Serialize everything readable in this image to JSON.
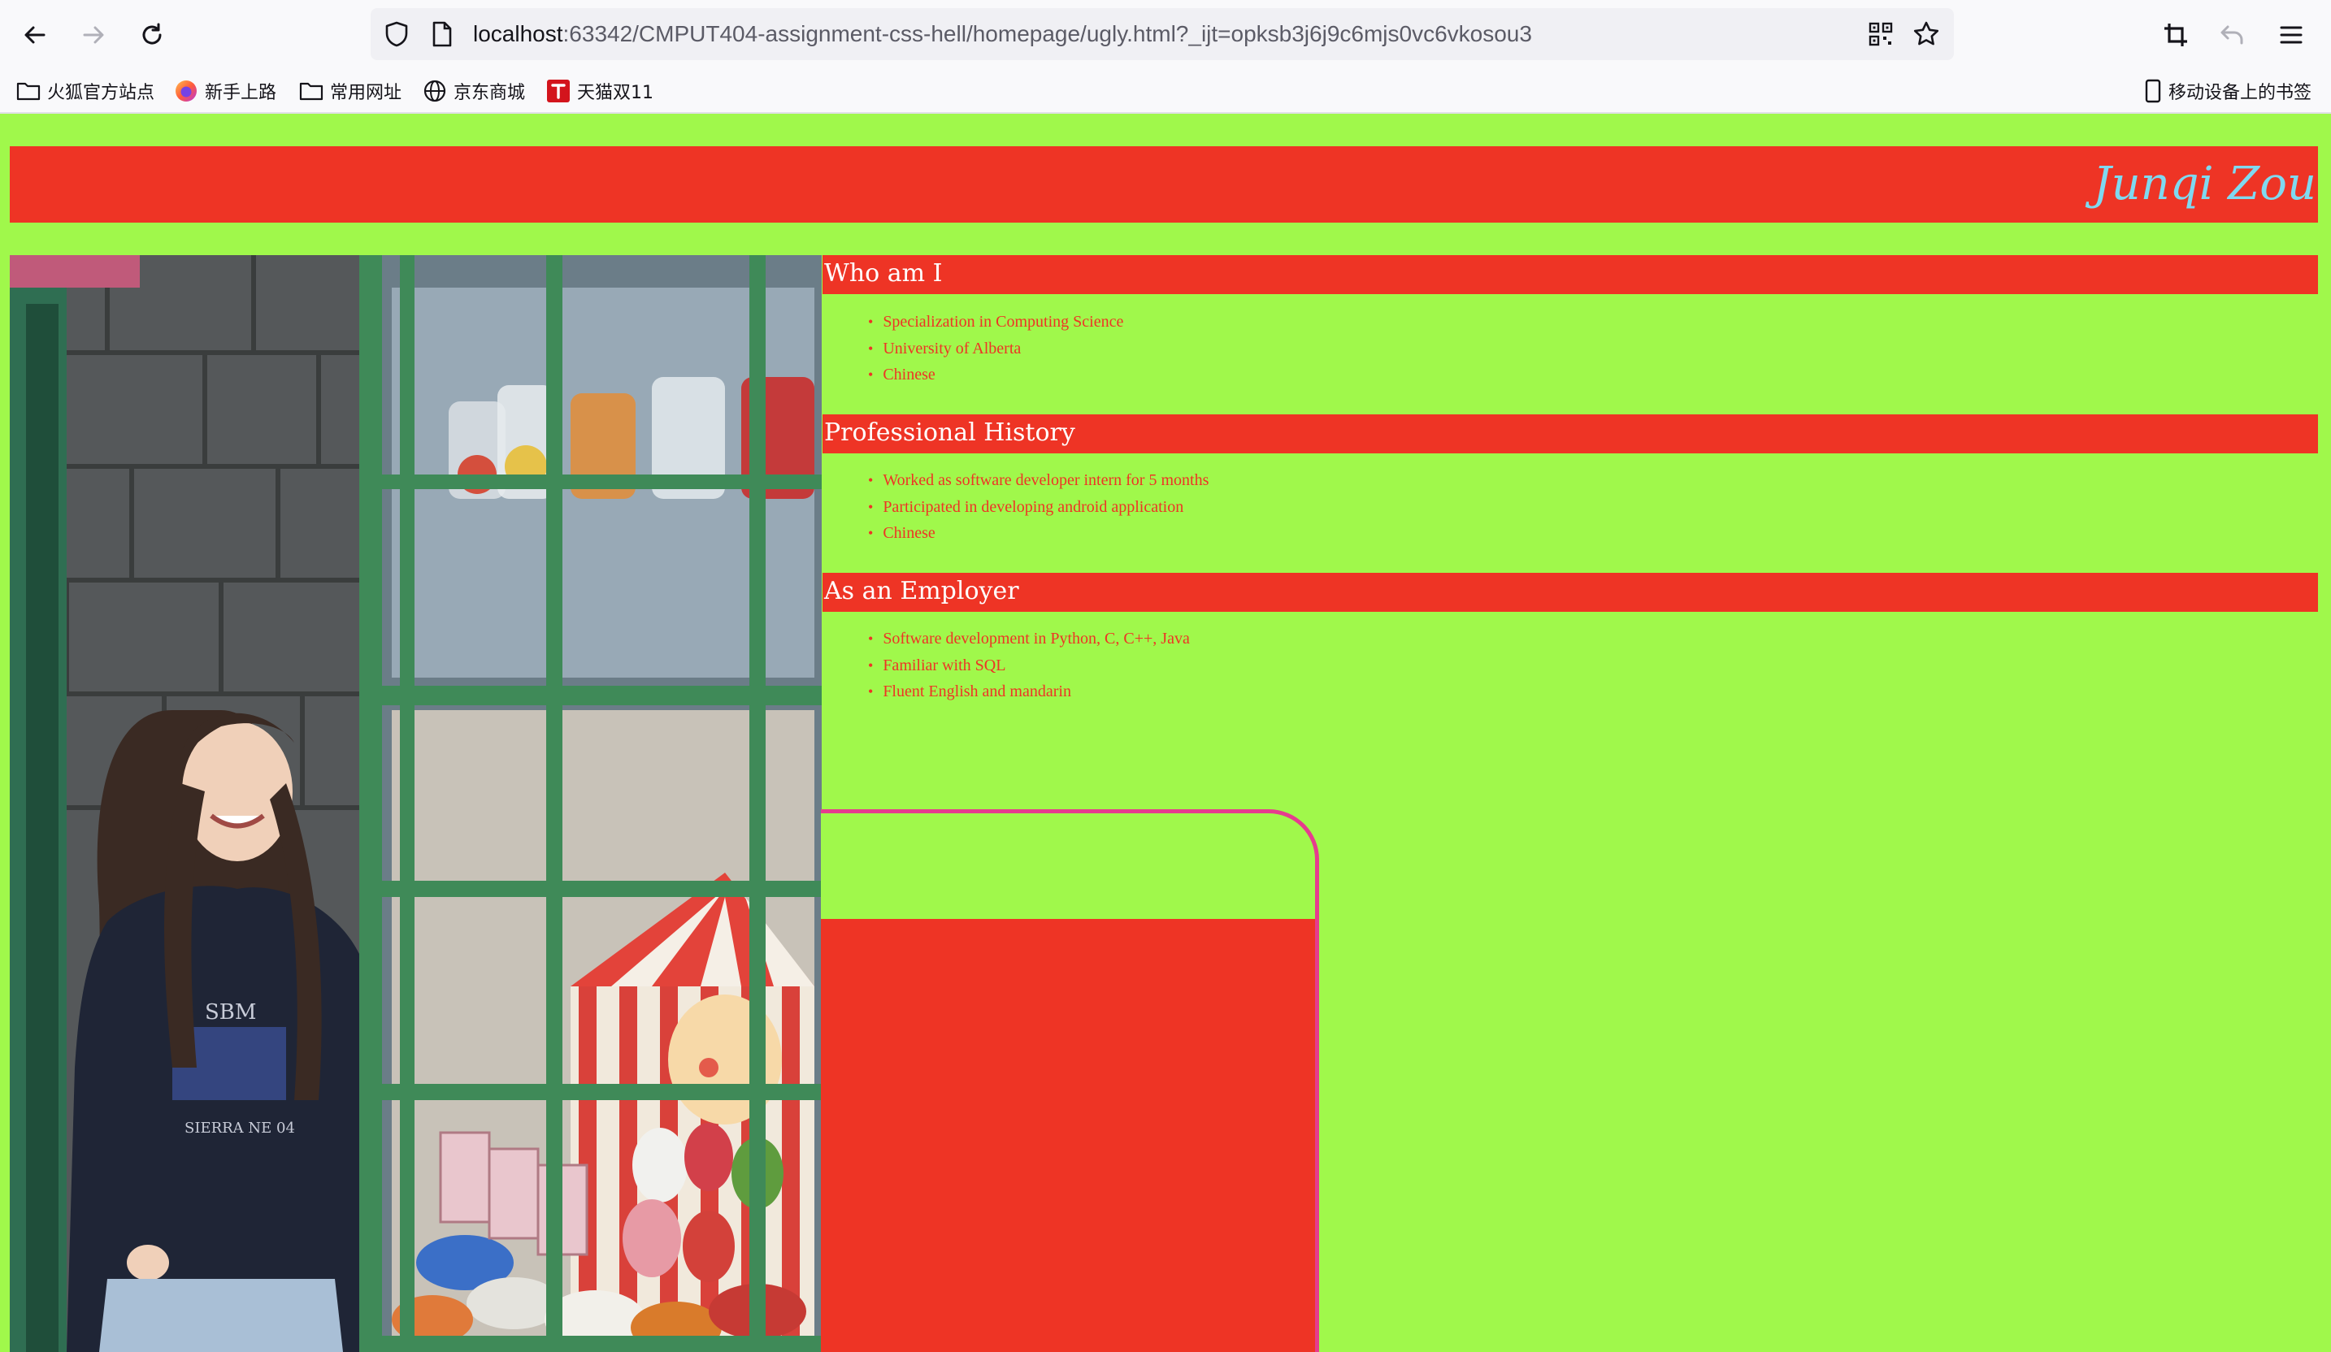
{
  "browser": {
    "url_host": "localhost",
    "url_rest": ":63342/CMPUT404-assignment-css-hell/homepage/ugly.html?_ijt=opksb3j6j9c6mjs0vc6vkosou3",
    "bookmarks": [
      {
        "label": "火狐官方站点",
        "icon": "folder-icon"
      },
      {
        "label": "新手上路",
        "icon": "firefox-icon"
      },
      {
        "label": "常用网址",
        "icon": "folder-icon"
      },
      {
        "label": "京东商城",
        "icon": "globe-icon"
      },
      {
        "label": "天猫双11",
        "icon": "tmall-icon"
      }
    ],
    "mobile_bookmarks": "移动设备上的书签"
  },
  "page": {
    "name": "Junqi Zou",
    "sections": [
      {
        "title": "Who am I",
        "items": [
          "Specialization in Computing Science",
          "University of Alberta",
          "Chinese"
        ]
      },
      {
        "title": "Professional History",
        "items": [
          "Worked as software developer intern for 5 months",
          "Participated in developing android application",
          "Chinese"
        ]
      },
      {
        "title": "As an Employer",
        "items": [
          "Software development in Python, C, C++, Java",
          "Familiar with SQL",
          "Fluent English and mandarin"
        ]
      }
    ]
  },
  "colors": {
    "page_bg": "#a0f84b",
    "banner": "#ee3425",
    "name_text": "#7fd9f0",
    "card_border": "#e63c8e"
  }
}
